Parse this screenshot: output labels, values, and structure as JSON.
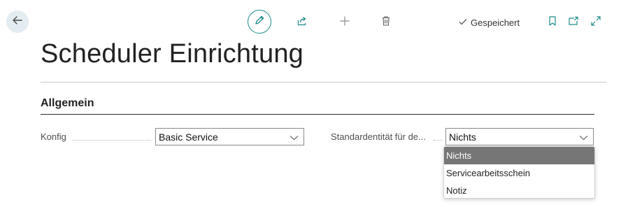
{
  "toolbar": {
    "back_icon": "arrow-left-icon",
    "edit_icon": "pencil-icon",
    "share_icon": "share-icon",
    "add_icon": "plus-icon",
    "delete_icon": "trash-icon",
    "saved_label": "Gespeichert",
    "bookmark_icon": "bookmark-icon",
    "open_new_window_icon": "open-in-new-icon",
    "expand_icon": "expand-icon"
  },
  "page": {
    "title": "Scheduler Einrichtung"
  },
  "section": {
    "title": "Allgemein"
  },
  "fields": {
    "config": {
      "label": "Konfig",
      "value": "Basic Service"
    },
    "default_entity": {
      "label": "Standardentität für de...",
      "value": "Nichts"
    }
  },
  "dropdown": {
    "options": [
      "Nichts",
      "Servicearbeitsschein",
      "Notiz"
    ],
    "selected_index": 0
  },
  "colors": {
    "accent": "#1b8a8a",
    "back_button_bg": "#e3ecf1",
    "selected_option_bg": "#767676"
  }
}
